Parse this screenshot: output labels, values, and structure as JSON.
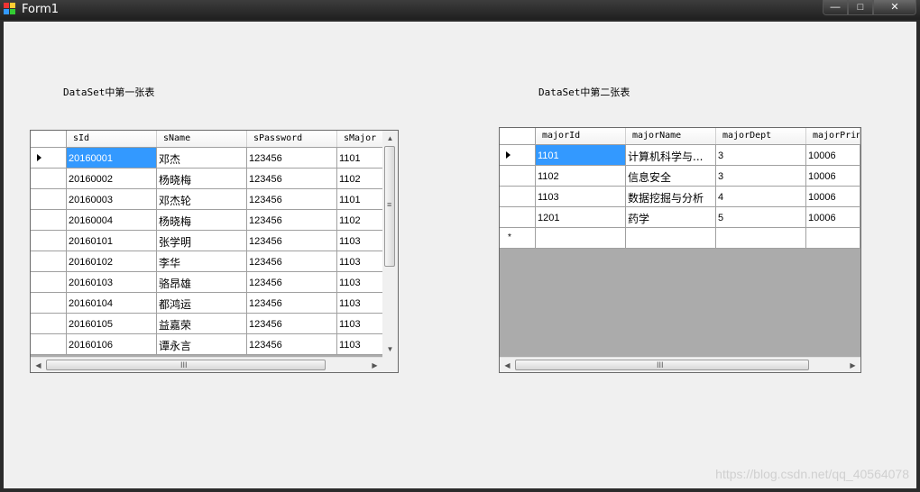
{
  "window": {
    "title": "Form1"
  },
  "labels": {
    "first": "DataSet中第一张表",
    "second": "DataSet中第二张表"
  },
  "grid1": {
    "columns": [
      "sId",
      "sName",
      "sPassword",
      "sMajor"
    ],
    "rows": [
      [
        "20160001",
        "邓杰",
        "123456",
        "1101"
      ],
      [
        "20160002",
        "杨晓梅",
        "123456",
        "1102"
      ],
      [
        "20160003",
        "邓杰轮",
        "123456",
        "1101"
      ],
      [
        "20160004",
        "杨晓梅",
        "123456",
        "1102"
      ],
      [
        "20160101",
        "张学明",
        "123456",
        "1103"
      ],
      [
        "20160102",
        "李华",
        "123456",
        "1103"
      ],
      [
        "20160103",
        "骆昂雄",
        "123456",
        "1103"
      ],
      [
        "20160104",
        "都鸿运",
        "123456",
        "1103"
      ],
      [
        "20160105",
        "益嘉荣",
        "123456",
        "1103"
      ],
      [
        "20160106",
        "谭永言",
        "123456",
        "1103"
      ]
    ]
  },
  "grid2": {
    "columns": [
      "majorId",
      "majorName",
      "majorDept",
      "majorPrin"
    ],
    "rows": [
      [
        "1101",
        "计算机科学与...",
        "3",
        "10006"
      ],
      [
        "1102",
        "信息安全",
        "3",
        "10006"
      ],
      [
        "1103",
        "数据挖掘与分析",
        "4",
        "10006"
      ],
      [
        "1201",
        "药学",
        "5",
        "10006"
      ]
    ],
    "new_row_marker": "*"
  },
  "scroll": {
    "grip_h": "III",
    "grip_v": "≡"
  },
  "watermark": "https://blog.csdn.net/qq_40564078"
}
